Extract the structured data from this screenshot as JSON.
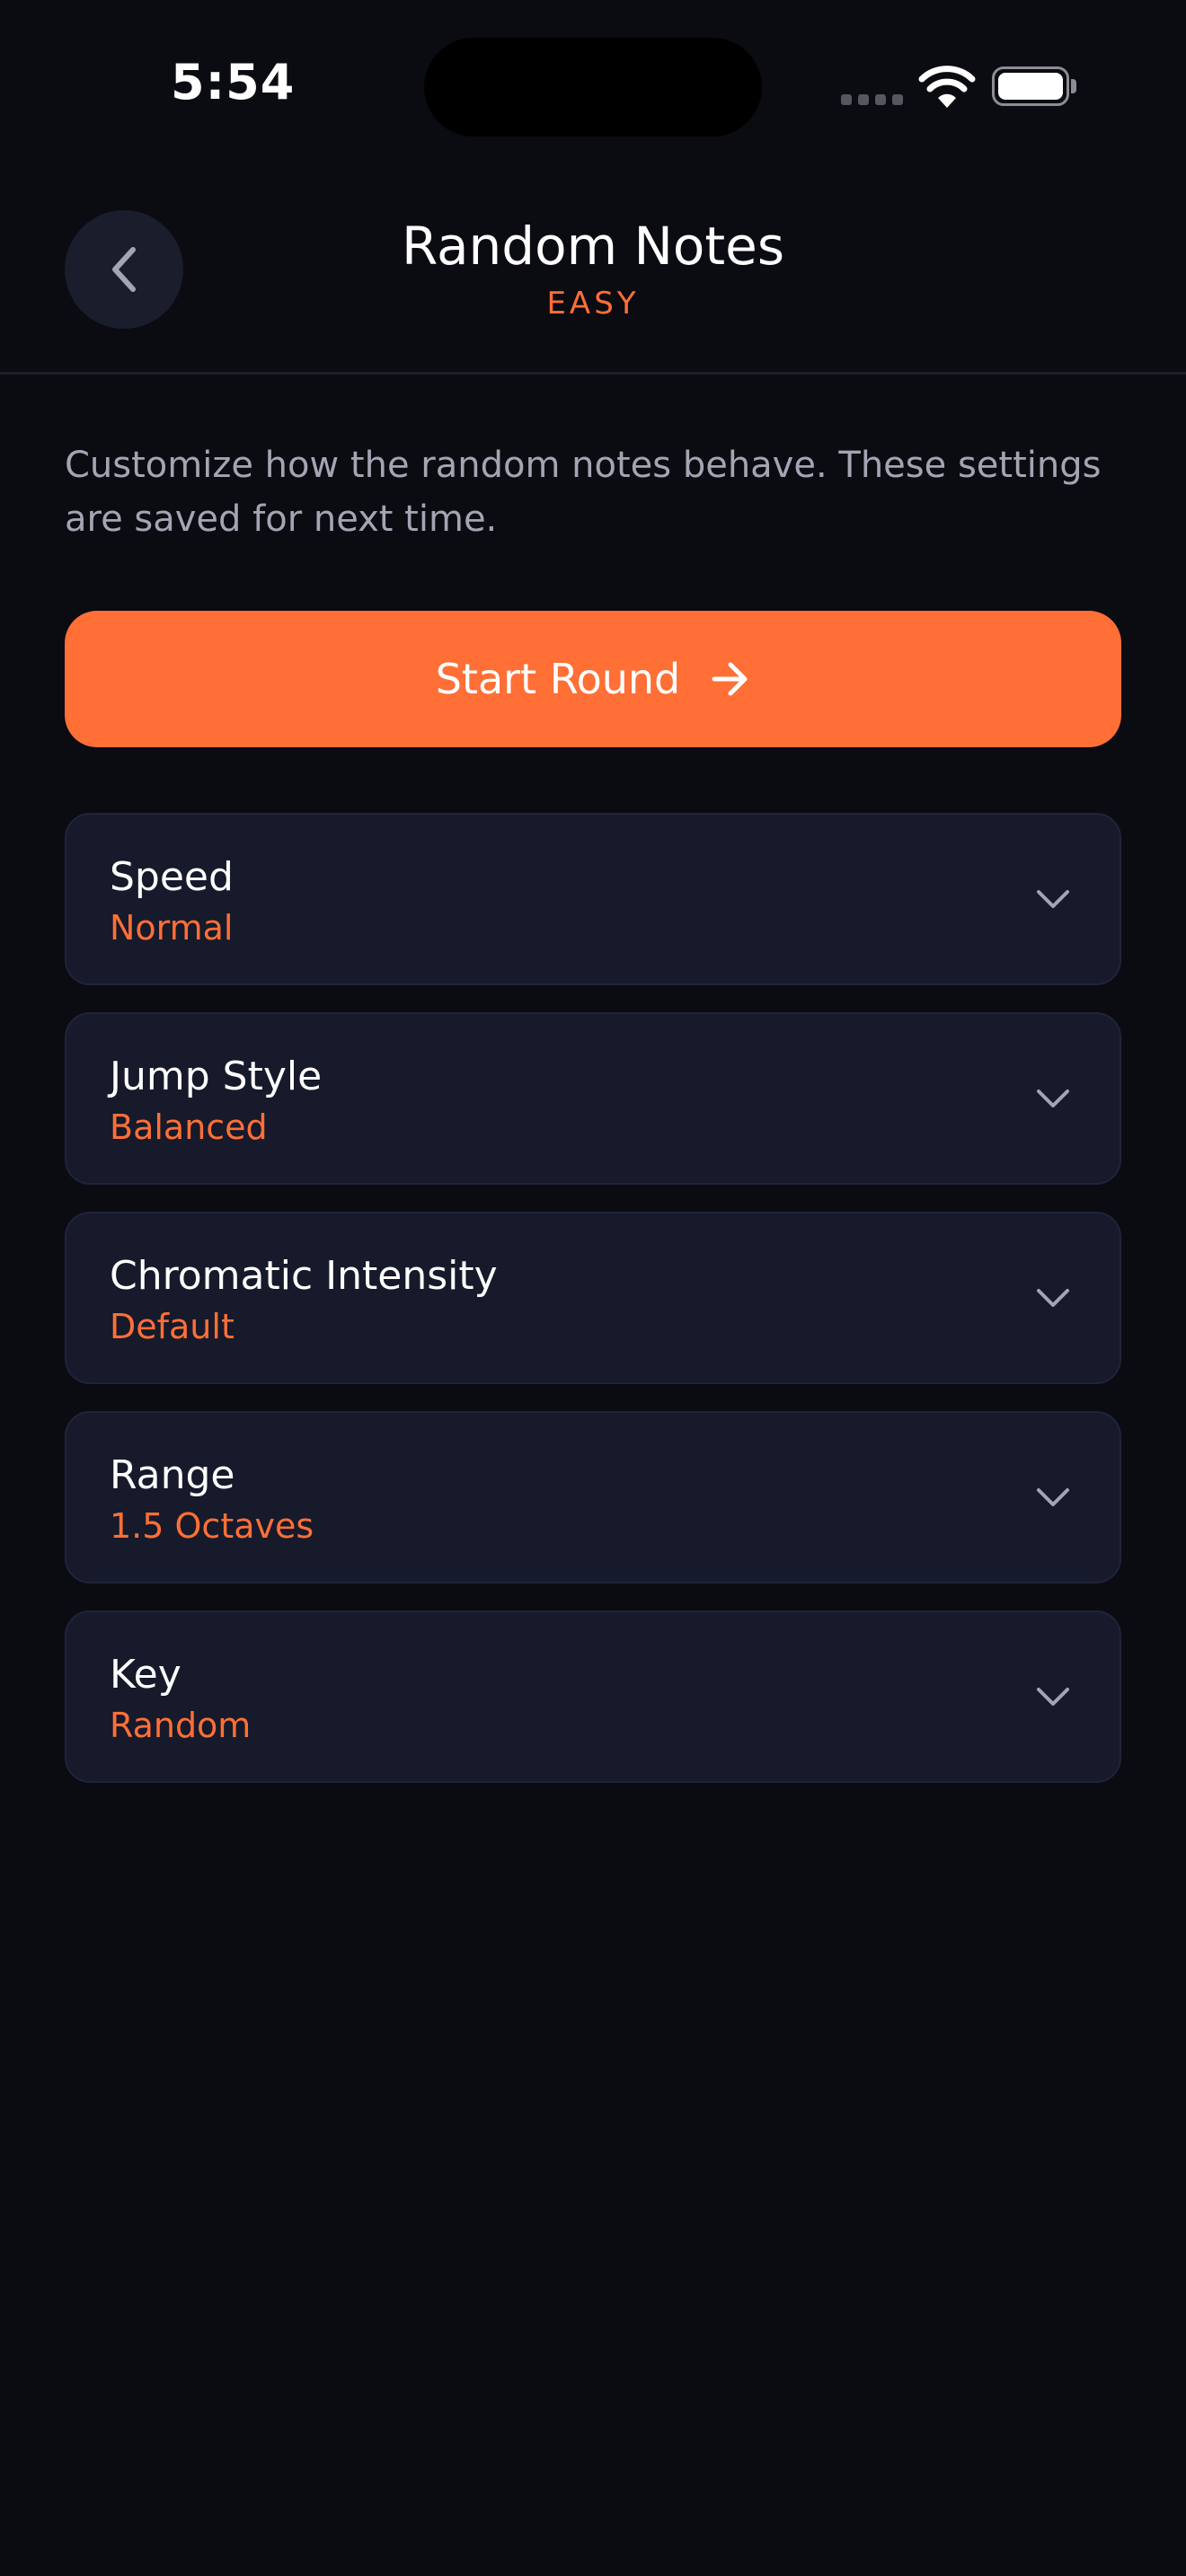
{
  "status_bar": {
    "time": "5:54"
  },
  "header": {
    "title": "Random Notes",
    "subtitle": "EASY",
    "back_icon": "chevron-left-icon"
  },
  "description": "Customize how the random notes behave. These settings are saved for next time.",
  "start_button": {
    "label": "Start Round",
    "icon": "arrow-right-icon"
  },
  "settings": [
    {
      "label": "Speed",
      "value": "Normal"
    },
    {
      "label": "Jump Style",
      "value": "Balanced"
    },
    {
      "label": "Chromatic Intensity",
      "value": "Default"
    },
    {
      "label": "Range",
      "value": "1.5 Octaves"
    },
    {
      "label": "Key",
      "value": "Random"
    }
  ],
  "colors": {
    "background": "#0b0b12",
    "accent": "#ff6f36",
    "card": "#161a2b",
    "muted_text": "#a3a5b3"
  }
}
